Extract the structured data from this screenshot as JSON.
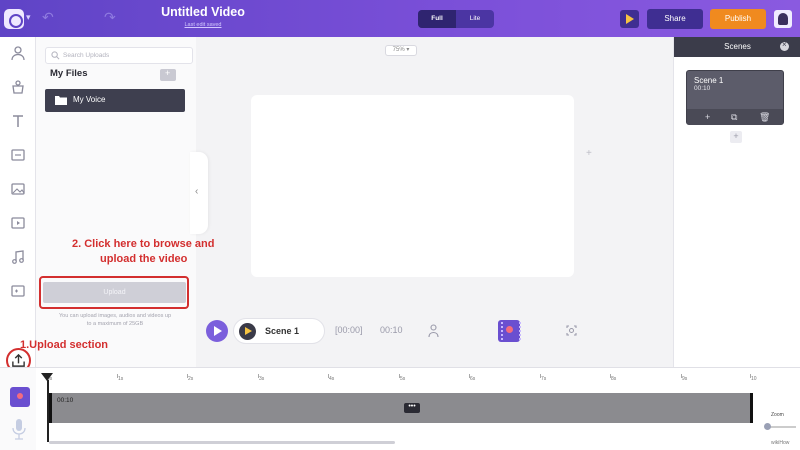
{
  "topbar": {
    "title": "Untitled Video",
    "subtitle": "Last edit saved",
    "toggle_full": "Full",
    "toggle_lite": "Lite",
    "share_label": "Share",
    "publish_label": "Publish",
    "colors": {
      "bar_start": "#5f44c6",
      "publish": "#f08a1f",
      "share": "#3f2e92"
    }
  },
  "rail": {
    "icons": [
      "character-icon",
      "props-icon",
      "text-icon",
      "background-icon",
      "images-icon",
      "video-icon",
      "music-icon",
      "effects-icon",
      "upload-icon",
      "more-icon"
    ]
  },
  "uploads": {
    "search_placeholder": "Search Uploads",
    "section_title": "My Files",
    "folder_label": "My Voice",
    "upload_label": "Upload",
    "note": "You can upload images, audios and videos up to a maximum of 25GB"
  },
  "annotations": {
    "step2_line1": "2. Click here to browse and",
    "step2_line2": "upload the video",
    "step1": "1.Upload section",
    "color": "#d32f2f"
  },
  "canvas": {
    "zoom": "75% ▾"
  },
  "playback": {
    "scene_label": "Scene 1",
    "time_start": "[00:00]",
    "duration": "00:10"
  },
  "scenes_panel": {
    "title": "Scenes",
    "card_name": "Scene 1",
    "card_duration": "00:10"
  },
  "timeline": {
    "ticks": [
      "0s",
      "1s",
      "2s",
      "3s",
      "4s",
      "5s",
      "6s",
      "7s",
      "8s",
      "9s",
      "10"
    ],
    "track_time": "00:10",
    "track_more": "•••",
    "zoom_label": "Zoom",
    "watermark": "wikiHow"
  }
}
